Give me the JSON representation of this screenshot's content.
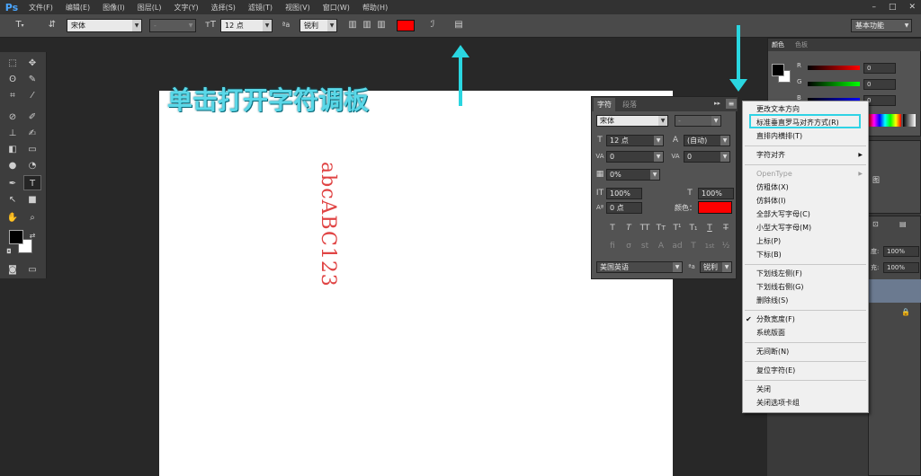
{
  "app": {
    "logo": "Ps"
  },
  "menubar": {
    "items": [
      "文件(F)",
      "编辑(E)",
      "图像(I)",
      "图层(L)",
      "文字(Y)",
      "选择(S)",
      "滤镜(T)",
      "视图(V)",
      "窗口(W)",
      "帮助(H)"
    ]
  },
  "window_controls": {
    "minimize": "–",
    "restore": "□",
    "close": "✕"
  },
  "options_bar": {
    "font_family": "宋体",
    "font_style": "-",
    "font_size": "12 点",
    "aa_label": "ªa",
    "antialias": "锐利",
    "text_color": "#ff0000",
    "workspace": "基本功能"
  },
  "canvas": {
    "vertical_text": "abcABC123",
    "text_color": "#e04444"
  },
  "annotation": {
    "hint": "单击打开字符调板",
    "color": "#2ad6e0"
  },
  "char_panel": {
    "tabs": [
      "字符",
      "段落"
    ],
    "font_family": "宋体",
    "font_style": "-",
    "font_size": "12 点",
    "leading": "(自动)",
    "kerning": "0",
    "tracking": "0",
    "tsume": "0%",
    "vscale": "100%",
    "hscale": "100%",
    "baseline": "0 点",
    "color_label": "颜色：",
    "language": "美国英语",
    "antialias": "锐利",
    "style_buttons": [
      "T",
      "T",
      "TT",
      "Tт",
      "T¹",
      "T₁",
      "T",
      "T̶"
    ],
    "ot_buttons": [
      "fi",
      "σ",
      "st",
      "A",
      "ad",
      "T",
      "1st",
      "½"
    ]
  },
  "panel_menu": {
    "items": [
      {
        "label": "更改文本方向",
        "checked": false,
        "submenu": false,
        "disabled": false
      },
      {
        "label": "标准垂直罗马对齐方式(R)",
        "checked": false,
        "submenu": false,
        "disabled": false
      },
      {
        "label": "直排内横排(T)",
        "checked": false,
        "submenu": false,
        "disabled": false
      },
      {
        "label": "字符对齐",
        "checked": false,
        "submenu": true,
        "disabled": false
      },
      {
        "label": "OpenType",
        "checked": false,
        "submenu": true,
        "disabled": true
      },
      {
        "label": "仿粗体(X)",
        "checked": false,
        "submenu": false,
        "disabled": false
      },
      {
        "label": "仿斜体(I)",
        "checked": false,
        "submenu": false,
        "disabled": false
      },
      {
        "label": "全部大写字母(C)",
        "checked": false,
        "submenu": false,
        "disabled": false
      },
      {
        "label": "小型大写字母(M)",
        "checked": false,
        "submenu": false,
        "disabled": false
      },
      {
        "label": "上标(P)",
        "checked": false,
        "submenu": false,
        "disabled": false
      },
      {
        "label": "下标(B)",
        "checked": false,
        "submenu": false,
        "disabled": false
      },
      {
        "label": "下划线左侧(F)",
        "checked": false,
        "submenu": false,
        "disabled": false
      },
      {
        "label": "下划线右侧(G)",
        "checked": false,
        "submenu": false,
        "disabled": false
      },
      {
        "label": "删除线(S)",
        "checked": false,
        "submenu": false,
        "disabled": false
      },
      {
        "label": "分数宽度(F)",
        "checked": true,
        "submenu": false,
        "disabled": false
      },
      {
        "label": "系统版面",
        "checked": false,
        "submenu": false,
        "disabled": false
      },
      {
        "label": "无间断(N)",
        "checked": false,
        "submenu": false,
        "disabled": false
      },
      {
        "label": "复位字符(E)",
        "checked": false,
        "submenu": false,
        "disabled": false
      },
      {
        "label": "关闭",
        "checked": false,
        "submenu": false,
        "disabled": false
      },
      {
        "label": "关闭选项卡组",
        "checked": false,
        "submenu": false,
        "disabled": false
      }
    ],
    "highlight_color": "#2fd3e5"
  },
  "color_panel": {
    "tabs": [
      "颜色",
      "色板"
    ],
    "channels": [
      {
        "name": "R",
        "value": "0"
      },
      {
        "name": "G",
        "value": "0"
      },
      {
        "name": "B",
        "value": "0"
      }
    ]
  },
  "layers_panel": {
    "opacity_label": "度:",
    "opacity": "100%",
    "fill_label": "充:",
    "fill": "100%",
    "partial_label": "图"
  }
}
